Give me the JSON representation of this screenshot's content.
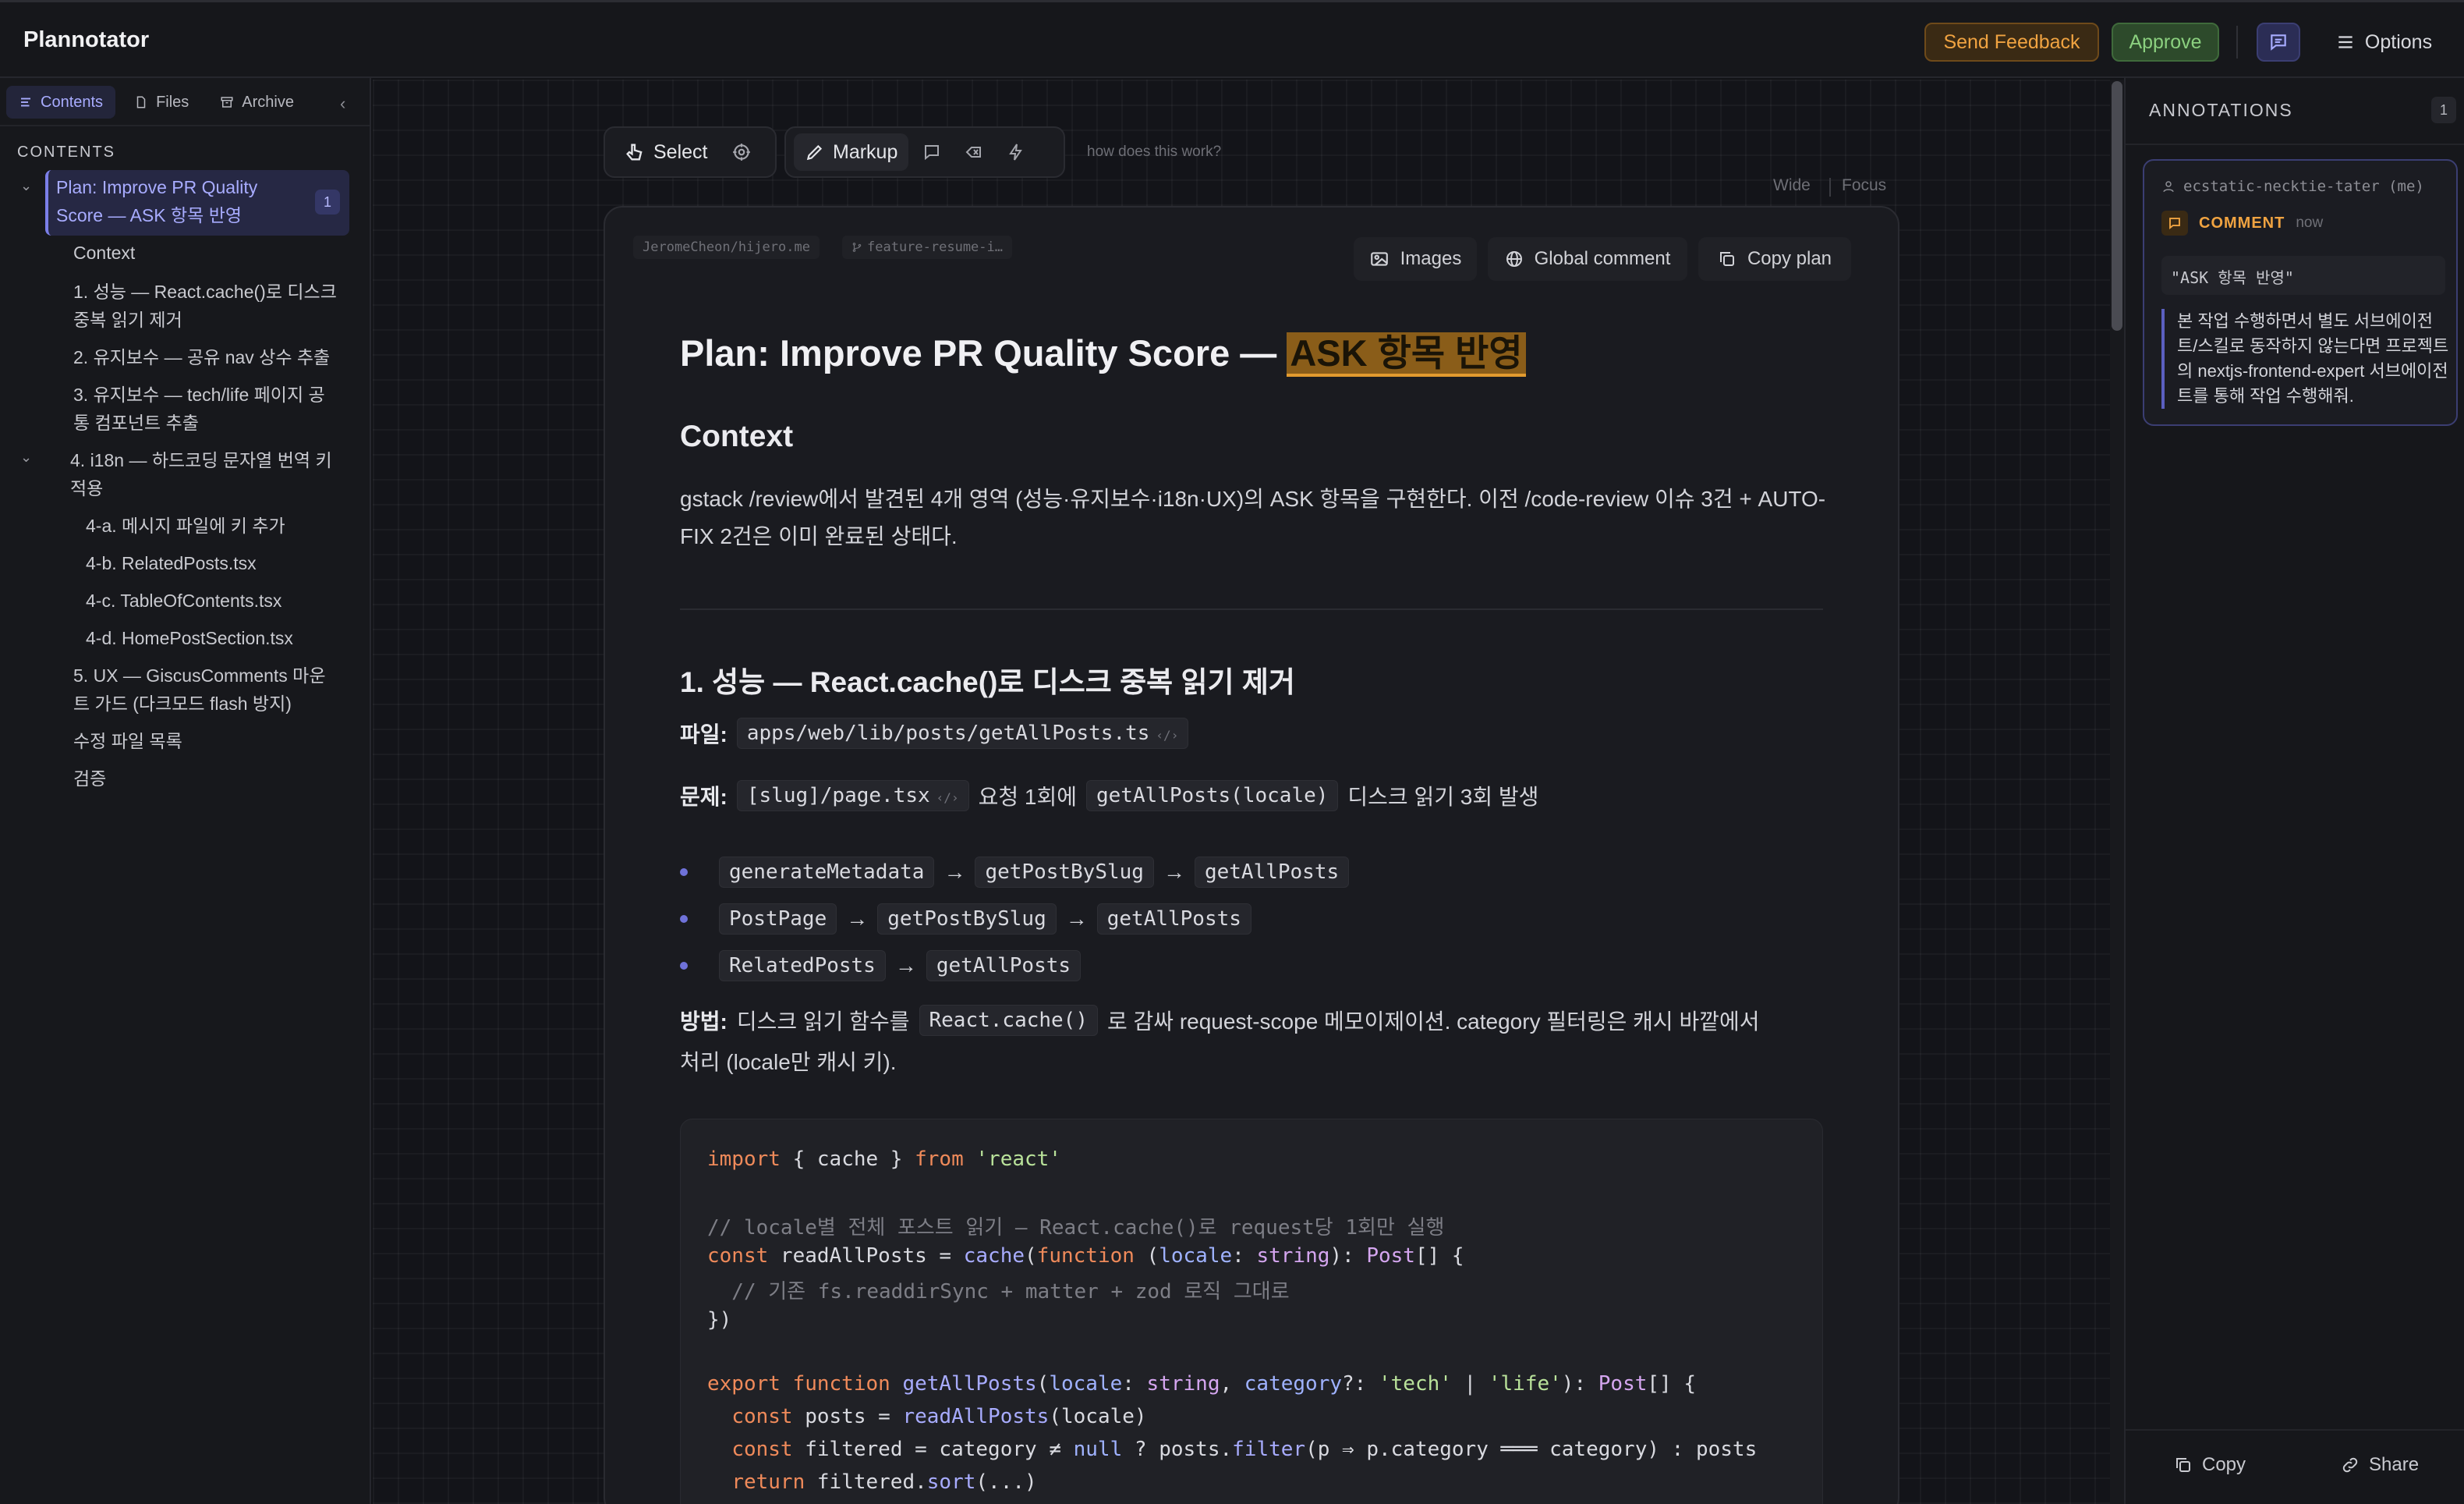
{
  "app": {
    "title": "Plannotator"
  },
  "header": {
    "send_feedback": "Send Feedback",
    "approve": "Approve",
    "options": "Options"
  },
  "sidebar": {
    "tabs": [
      {
        "label": "Contents",
        "icon": "list-icon",
        "active": true
      },
      {
        "label": "Files",
        "icon": "file-icon",
        "active": false
      },
      {
        "label": "Archive",
        "icon": "archive-icon",
        "active": false
      }
    ],
    "heading": "CONTENTS",
    "items": [
      {
        "label": "Plan: Improve PR Quality Score — ASK 항목 반영",
        "badge": "1"
      },
      {
        "label": "Context"
      },
      {
        "label": "1. 성능 — React.cache()로 디스크 중복 읽기 제거"
      },
      {
        "label": "2. 유지보수 — 공유 nav 상수 추출"
      },
      {
        "label": "3. 유지보수 — tech/life 페이지 공통 컴포넌트 추출"
      },
      {
        "label": "4. i18n — 하드코딩 문자열 번역 키 적용"
      },
      {
        "label": "4-a. 메시지 파일에 키 추가"
      },
      {
        "label": "4-b. RelatedPosts.tsx"
      },
      {
        "label": "4-c. TableOfContents.tsx"
      },
      {
        "label": "4-d. HomePostSection.tsx"
      },
      {
        "label": "5. UX — GiscusComments 마운트 가드 (다크모드 flash 방지)"
      },
      {
        "label": "수정 파일 목록"
      },
      {
        "label": "검증"
      }
    ]
  },
  "toolbar": {
    "select": "Select",
    "markup": "Markup",
    "help": "how does this work?",
    "wide": "Wide",
    "focus": "Focus"
  },
  "doc": {
    "repo": "JeromeCheon/hijero.me",
    "branch": "feature-resume-i…",
    "actions": {
      "images": "Images",
      "global_comment": "Global comment",
      "copy_plan": "Copy plan"
    },
    "title_prefix": "Plan: Improve PR Quality Score — ",
    "title_highlight": "ASK 항목 반영",
    "context_heading": "Context",
    "context_text": "gstack /review에서 발견된 4개 영역 (성능·유지보수·i18n·UX)의 ASK 항목을 구현한다. 이전 /code-review 이슈 3건 + AUTO-FIX 2건은 이미 완료된 상태다.",
    "section1_heading": "1. 성능 — React.cache()로 디스크 중복 읽기 제거",
    "file_label": "파일:",
    "file_path": "apps/web/lib/posts/getAllPosts.ts",
    "problem_label": "문제:",
    "problem_code1": "[slug]/page.tsx",
    "problem_mid": "요청 1회에",
    "problem_code2": "getAllPosts(locale)",
    "problem_tail": "디스크 읽기 3회 발생",
    "bullets": [
      [
        "generateMetadata",
        "getPostBySlug",
        "getAllPosts"
      ],
      [
        "PostPage",
        "getPostBySlug",
        "getAllPosts"
      ],
      [
        "RelatedPosts",
        "getAllPosts"
      ]
    ],
    "arrow": "→",
    "method_label": "방법:",
    "method_pre": "디스크 읽기 함수를",
    "method_code": "React.cache()",
    "method_post": "로 감싸 request-scope 메모이제이션. category 필터링은 캐시 바깥에서",
    "method_line2": "처리 (locale만 캐시 키)."
  },
  "annotations": {
    "title": "ANNOTATIONS",
    "count": "1",
    "card": {
      "user": "ecstatic-necktie-tater (me)",
      "type": "COMMENT",
      "time": "now",
      "quote": "\"ASK 항목 반영\"",
      "body": "본 작업 수행하면서 별도 서브에이전트/스킬로 동작하지 않는다면 프로젝트의 nextjs-frontend-expert 서브에이전트를 통해 작업 수행해줘."
    },
    "copy": "Copy",
    "share": "Share"
  },
  "colors": {
    "accent": "#7b7fe8",
    "feedback": "#f0a341",
    "approve": "#8bd07f",
    "highlight": "#8a5d19"
  }
}
